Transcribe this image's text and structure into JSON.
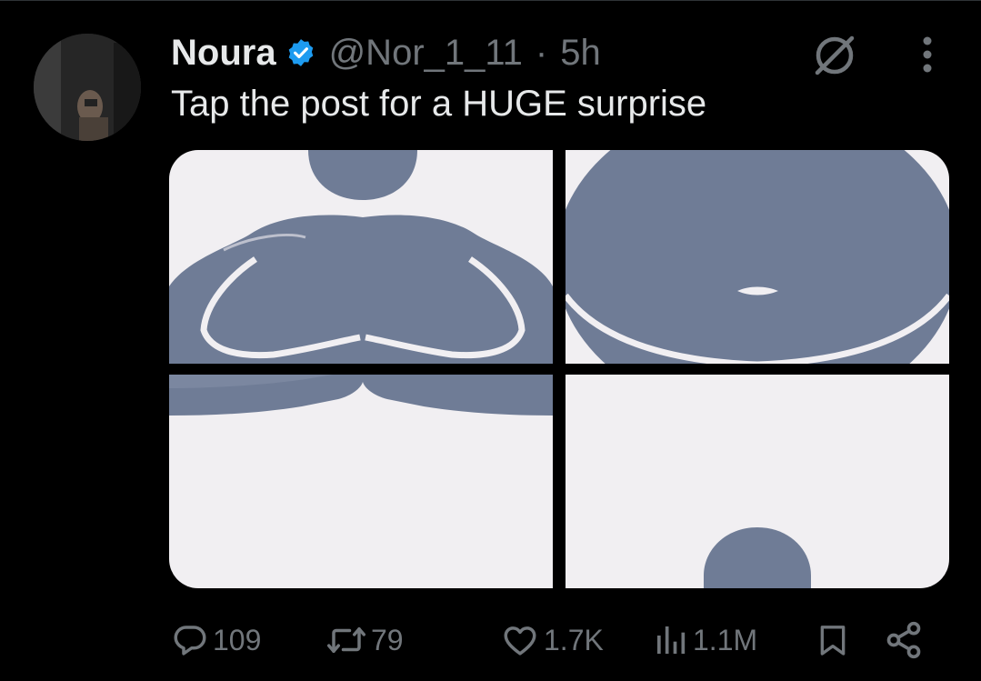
{
  "post": {
    "author_name": "Noura",
    "handle": "@Nor_1_11",
    "separator": "·",
    "time": "5h",
    "text": "Tap the post for a HUGE surprise",
    "verified": true
  },
  "icons": {
    "verified": "verified-badge-icon",
    "grok": "grok-icon",
    "more": "more-vertical-icon",
    "reply": "reply-icon",
    "repost": "repost-icon",
    "like": "like-icon",
    "views": "views-icon",
    "bookmark": "bookmark-icon",
    "share": "share-icon"
  },
  "stats": {
    "replies": "109",
    "reposts": "79",
    "likes": "1.7K",
    "views": "1.1M"
  },
  "colors": {
    "background": "#000000",
    "text_primary": "#e7e9ea",
    "text_secondary": "#71767b",
    "verified": "#1d9bf0",
    "figure": "#6f7c96",
    "image_bg": "#f1eff2"
  }
}
